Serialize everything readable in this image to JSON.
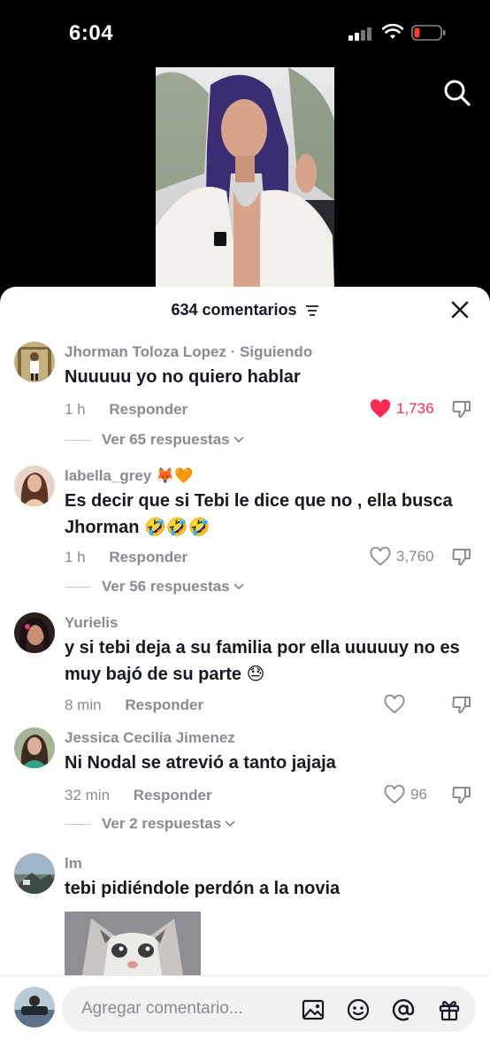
{
  "status": {
    "time": "6:04"
  },
  "header": {
    "title": "634 comentarios"
  },
  "comments": [
    {
      "user": "Jhorman Toloza Lopez",
      "following": "· Siguiendo",
      "text": "Nuuuuu yo no quiero hablar",
      "time": "1 h",
      "reply_label": "Responder",
      "likes": "1,736",
      "liked": true,
      "view_replies": "Ver 65 respuestas"
    },
    {
      "user": "labella_grey",
      "user_emoji": "🦊🧡",
      "text": "Es decir que si Tebi le dice que no , ella busca Jhorman",
      "text_emoji": "🤣🤣🤣",
      "time": "1 h",
      "reply_label": "Responder",
      "likes": "3,760",
      "view_replies": "Ver 56 respuestas"
    },
    {
      "user": "Yurielis",
      "text": "y si tebi deja a su familia por ella uuuuuy no es muy bajó de su parte",
      "text_emoji": "😓",
      "time": "8 min",
      "reply_label": "Responder",
      "likes": ""
    },
    {
      "user": "Jessica Cecilia Jimenez",
      "text": "Ni Nodal se atrevió a tanto jajaja",
      "time": "32 min",
      "reply_label": "Responder",
      "likes": "96",
      "view_replies": "Ver 2 respuestas"
    },
    {
      "user": "lm",
      "text": "tebi pidiéndole perdón a la novia"
    }
  ],
  "composer": {
    "placeholder": "Agregar comentario..."
  },
  "icons": {
    "search": "search-icon",
    "filter": "filter-icon",
    "close": "close-icon",
    "heart": "heart-icon",
    "dislike": "thumbs-down-icon",
    "image": "image-icon",
    "emoji": "emoji-icon",
    "mention": "at-icon",
    "gift": "gift-icon"
  },
  "colors": {
    "like_active": "#fe2c55",
    "text_primary": "#161823",
    "text_secondary": "#8a8b91"
  }
}
